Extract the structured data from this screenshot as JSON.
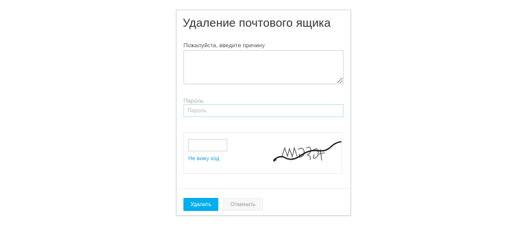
{
  "dialog": {
    "title": "Удаление почтового ящика",
    "reason": {
      "label": "Пожалуйста, введите причину",
      "value": ""
    },
    "password": {
      "label": "Пароль",
      "placeholder": "Пароль",
      "value": ""
    },
    "captcha": {
      "input_value": "",
      "link_text": "Не вижу код",
      "image_icon": "captcha-image"
    },
    "buttons": {
      "delete_label": "Удалить",
      "cancel_label": "Отменить"
    }
  },
  "colors": {
    "accent": "#00aeef",
    "link": "#2a9fd8",
    "border": "#d9d9d9",
    "focus_border": "#bfe4f5",
    "cancel_bg": "#f7f7f7"
  }
}
